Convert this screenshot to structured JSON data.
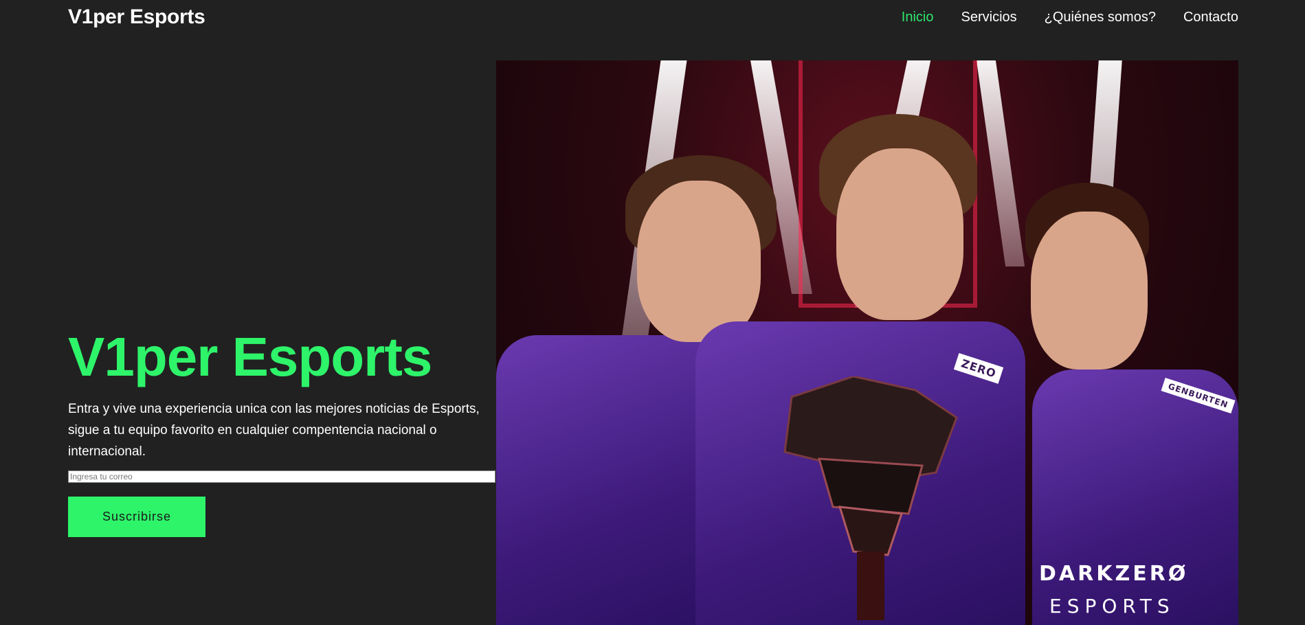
{
  "header": {
    "logo": "V1per Esports",
    "nav": [
      {
        "label": "Inicio",
        "active": true
      },
      {
        "label": "Servicios",
        "active": false
      },
      {
        "label": "¿Quiénes somos?",
        "active": false
      },
      {
        "label": "Contacto",
        "active": false
      }
    ]
  },
  "hero": {
    "title": "V1per Esports",
    "description": "Entra y vive una experiencia unica con las mejores noticias de Esports, sigue a tu equipo favorito en cualquier compentencia nacional o internacional.",
    "email_placeholder": "Ingresa tu correo",
    "email_value": "",
    "subscribe_label": "Suscribirse",
    "image": {
      "jersey_text_1": "DARKZERØ",
      "jersey_text_2": "ESPORTS",
      "shoulder_tag_1": "ZERO",
      "shoulder_tag_2": "GENBURTEN"
    }
  },
  "colors": {
    "background": "#212121",
    "accent": "#2ef46a",
    "nav_active": "#2ee66b",
    "text": "#ffffff"
  }
}
